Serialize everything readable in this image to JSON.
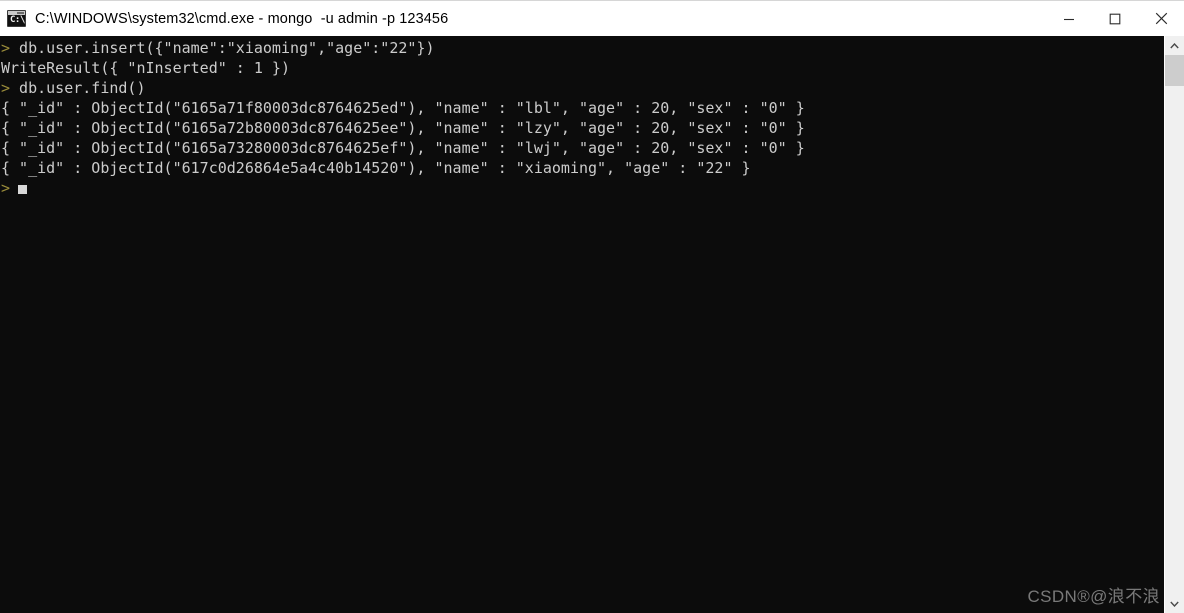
{
  "window": {
    "title": "C:\\WINDOWS\\system32\\cmd.exe - mongo  -u admin -p 123456",
    "icon": "cmd-console-icon",
    "icon_glyph": "C:\\_",
    "background_color": "#0c0c0c",
    "titlebar_color": "#ffffff",
    "controls": {
      "minimize_label": "—",
      "maximize_label": "□",
      "close_label": "✕"
    }
  },
  "console": {
    "text_color": "#cccccc",
    "prompt_color": "#9a8c3a",
    "prompt_symbol": ">",
    "lines": [
      {
        "prompt": ">",
        "text": " db.user.insert({\"name\":\"xiaoming\",\"age\":\"22\"})"
      },
      {
        "prompt": "",
        "text": "WriteResult({ \"nInserted\" : 1 })"
      },
      {
        "prompt": ">",
        "text": " db.user.find()"
      },
      {
        "prompt": "",
        "text": "{ \"_id\" : ObjectId(\"6165a71f80003dc8764625ed\"), \"name\" : \"lbl\", \"age\" : 20, \"sex\" : \"0\" }"
      },
      {
        "prompt": "",
        "text": "{ \"_id\" : ObjectId(\"6165a72b80003dc8764625ee\"), \"name\" : \"lzy\", \"age\" : 20, \"sex\" : \"0\" }"
      },
      {
        "prompt": "",
        "text": "{ \"_id\" : ObjectId(\"6165a73280003dc8764625ef\"), \"name\" : \"lwj\", \"age\" : 20, \"sex\" : \"0\" }"
      },
      {
        "prompt": "",
        "text": "{ \"_id\" : ObjectId(\"617c0d26864e5a4c40b14520\"), \"name\" : \"xiaoming\", \"age\" : \"22\" }"
      },
      {
        "prompt": ">",
        "text": ""
      }
    ]
  },
  "scrollbar": {
    "up_arrow": "▲",
    "down_arrow": "▼",
    "track_color": "#f0f0f0",
    "thumb_color": "#cdcdcd"
  },
  "watermark": {
    "text": "CSDN®@浪不浪"
  }
}
